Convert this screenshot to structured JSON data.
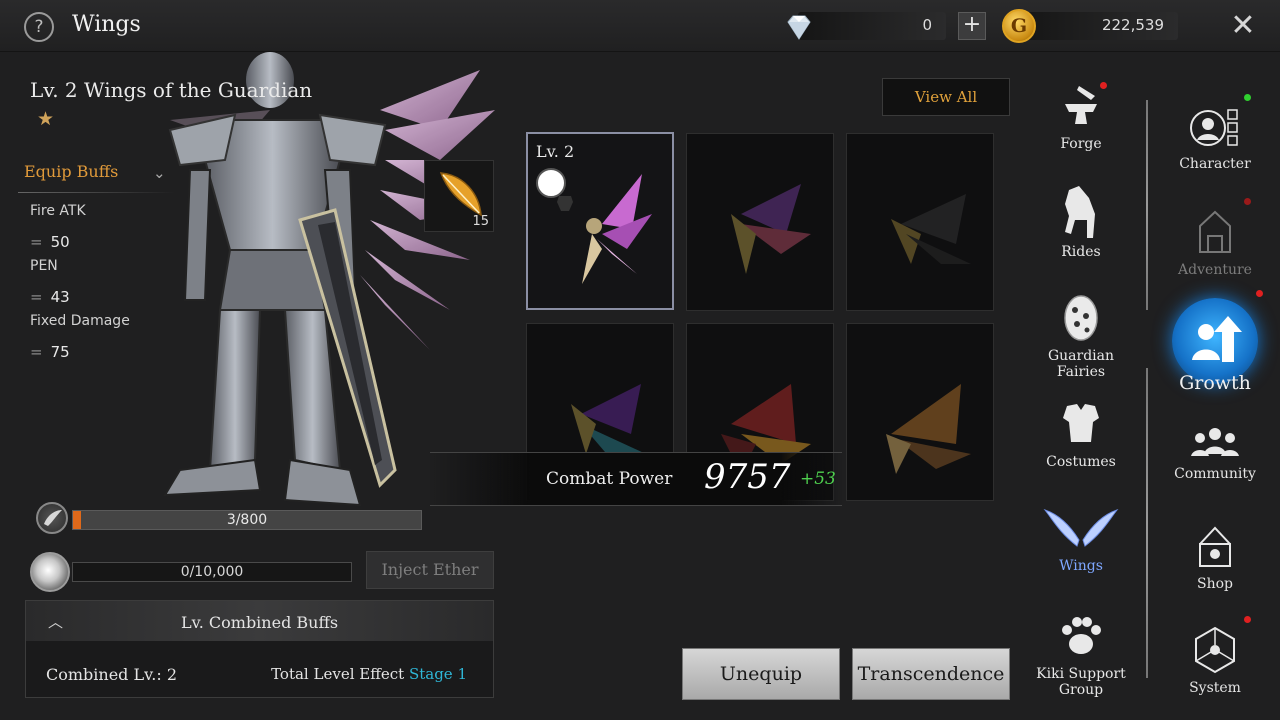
{
  "header": {
    "title": "Wings",
    "diamonds": "0",
    "gold": "222,539",
    "gold_symbol": "G"
  },
  "item": {
    "name": "Lv. 2 Wings of the Guardian",
    "stars": 1,
    "equip_buffs_label": "Equip Buffs",
    "buffs": [
      {
        "name": "Fire ATK",
        "value": "50"
      },
      {
        "name": "PEN",
        "value": "43"
      },
      {
        "name": "Fixed Damage",
        "value": "75"
      }
    ],
    "feather_count": "15"
  },
  "progress": {
    "exp_text": "3/800",
    "exp_fraction": 0.00375,
    "ether_text": "0/10,000",
    "inject_label": "Inject Ether"
  },
  "combined": {
    "title": "Lv. Combined Buffs",
    "combined_lv": "Combined Lv.: 2",
    "total_effect_label": "Total Level Effect",
    "stage": "Stage 1"
  },
  "grid": {
    "view_all_label": "View All",
    "selected_level": "Lv. 2"
  },
  "combat_power": {
    "label": "Combat Power",
    "value": "9757",
    "delta": "+53"
  },
  "actions": {
    "unequip": "Unequip",
    "transcendence": "Transcendence"
  },
  "submenu": [
    {
      "label": "Forge",
      "icon": "anvil-icon"
    },
    {
      "label": "Rides",
      "icon": "horse-icon"
    },
    {
      "label": "Guardian Fairies",
      "icon": "egg-icon"
    },
    {
      "label": "Costumes",
      "icon": "armor-icon"
    },
    {
      "label": "Wings",
      "icon": "wings-icon"
    },
    {
      "label": "Kiki Support Group",
      "icon": "paw-icon"
    }
  ],
  "mainnav": [
    {
      "label": "Character",
      "icon": "character-icon"
    },
    {
      "label": "Adventure",
      "icon": "adventure-icon"
    },
    {
      "label": "Growth",
      "icon": "growth-icon"
    },
    {
      "label": "Community",
      "icon": "community-icon"
    },
    {
      "label": "Shop",
      "icon": "shop-icon"
    },
    {
      "label": "System",
      "icon": "system-icon"
    }
  ],
  "colors": {
    "accent_orange": "#e09a3a",
    "stage_cyan": "#2fb6d6",
    "delta_green": "#4fd04f",
    "growth_blue": "#1b8de0",
    "notify_red": "#e02020"
  }
}
